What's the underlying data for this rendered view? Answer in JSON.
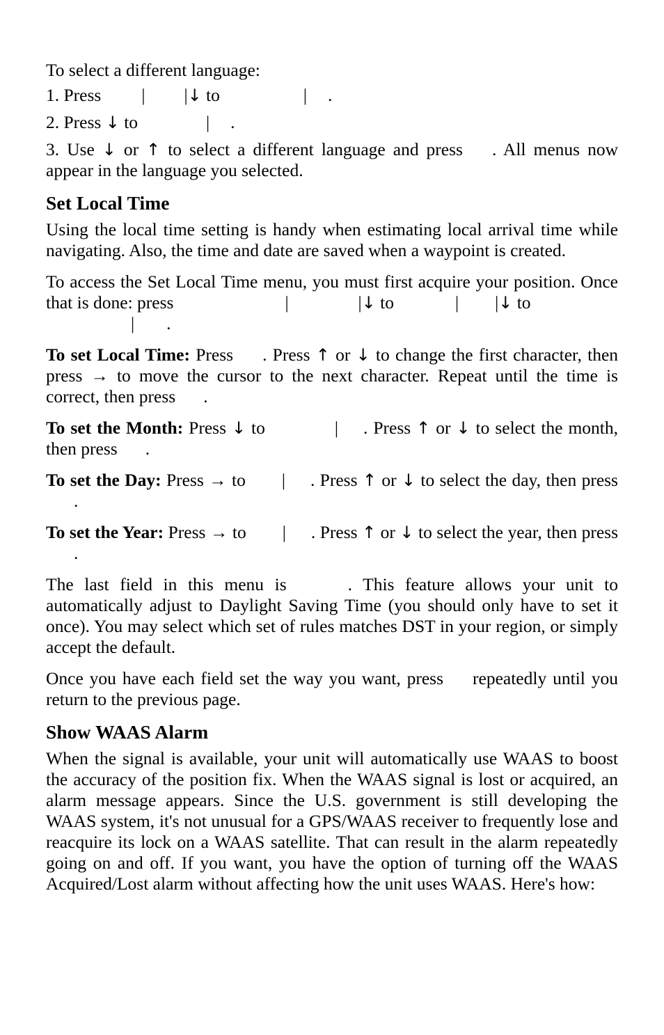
{
  "document": {
    "type": "manual-page",
    "page_background": "#ffffff",
    "text_color": "#000000"
  },
  "intro": {
    "lead_in": "To select a different language:",
    "steps": [
      {
        "number": "1.",
        "segments": [
          {
            "type": "text",
            "value": "1. Press"
          },
          {
            "type": "gap",
            "width": "g1"
          },
          {
            "type": "bar",
            "value": "|"
          },
          {
            "type": "gap",
            "width": "g2"
          },
          {
            "type": "bar",
            "value": "|"
          },
          {
            "type": "arrow",
            "value": "↓"
          },
          {
            "type": "text",
            "value": " to"
          },
          {
            "type": "gap",
            "width": "g3"
          },
          {
            "type": "bar",
            "value": "|"
          },
          {
            "type": "gap",
            "width": "g4"
          },
          {
            "type": "text",
            "value": "."
          }
        ]
      },
      {
        "number": "2.",
        "segments": [
          {
            "type": "text",
            "value": "2. Press"
          },
          {
            "type": "arrow",
            "value": "↓"
          },
          {
            "type": "text",
            "value": " to"
          },
          {
            "type": "gap",
            "width": "g5"
          },
          {
            "type": "bar",
            "value": "|"
          },
          {
            "type": "gap",
            "width": "g6"
          },
          {
            "type": "text",
            "value": "."
          }
        ]
      }
    ],
    "step3_part1": "3. Use ",
    "step3_arrow_down": "↓",
    "step3_or": " or ",
    "step3_arrow_up": "↑",
    "step3_part2": " to select a different language and press",
    "step3_part3": ". All menus now appear in the language you selected."
  },
  "set_local_time": {
    "heading": "Set Local Time",
    "para1": "Using the local time setting is handy when estimating local arrival time while navigating. Also, the time and date are saved when a waypoint is created.",
    "para2_part1": "To access the Set Local Time menu, you must first acquire your position. Once that is done: press",
    "para2_arrow1": "↓",
    "para2_to1": " to",
    "para2_arrow2": "↓",
    "para2_to2": " to",
    "para2_end": ".",
    "bar": "|",
    "local_time": {
      "lead": "To set Local Time:",
      "part1": " Press",
      "part2": ". Press ",
      "arrow_up": "↑",
      "or": " or ",
      "arrow_down": "↓",
      "part3": " to change the first character, then press ",
      "arrow_right": "→",
      "part4": " to move the cursor to the next character. Repeat until the time is correct, then press",
      "part5": "."
    },
    "month": {
      "lead": "To set the Month:",
      "part1": " Press ",
      "arrow_down": "↓",
      "part2": " to",
      "part3": ". Press ",
      "arrow_up": "↑",
      "or": " or ",
      "arrow_down2": "↓",
      "part4": " to select the month, then press",
      "part5": "."
    },
    "day": {
      "lead": "To set the Day:",
      "part1": " Press ",
      "arrow_right": "→",
      "part2": " to",
      "part3": ". Press ",
      "arrow_up": "↑",
      "or": " or ",
      "arrow_down": "↓",
      "part4": " to select the day, then press",
      "part5": "."
    },
    "year": {
      "lead": "To set the Year:",
      "part1": " Press ",
      "arrow_right": "→",
      "part2": " to",
      "part3": ". Press ",
      "arrow_up": "↑",
      "or": " or ",
      "arrow_down": "↓",
      "part4": " to select the year, then press",
      "part5": "."
    },
    "dst_part1": "The last field in this menu is",
    "dst_part2": ". This feature allows your unit to automatically adjust to Daylight Saving Time (you should only have to set it once). You may select which set of rules matches DST in your region, or simply accept the default.",
    "exit_part1": "Once you have each field set the way you want, press",
    "exit_part2": "repeatedly until you return to the previous page."
  },
  "show_waas_alarm": {
    "heading": "Show WAAS Alarm",
    "para1": "When the signal is available, your unit will automatically use WAAS to boost the accuracy of the position fix. When the WAAS signal is lost or acquired, an alarm message appears. Since the U.S. government is still developing the WAAS system, it's not unusual for a GPS/WAAS receiver to frequently lose and reacquire its lock on a WAAS satellite. That can result in the alarm repeatedly going on and off. If you want, you have the option of turning off the WAAS Acquired/Lost alarm without affecting how the unit uses WAAS. Here's how:"
  }
}
